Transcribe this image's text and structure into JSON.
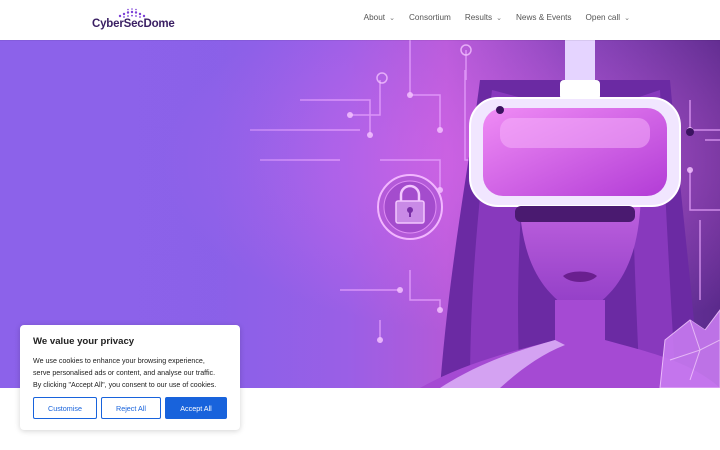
{
  "brand": {
    "name": "CyberSecDome"
  },
  "nav": {
    "items": [
      {
        "label": "About",
        "has_dropdown": true
      },
      {
        "label": "Consortium",
        "has_dropdown": false
      },
      {
        "label": "Results",
        "has_dropdown": true
      },
      {
        "label": "News & Events",
        "has_dropdown": false
      },
      {
        "label": "Open call",
        "has_dropdown": true
      }
    ],
    "chevron": "⌄"
  },
  "hero": {
    "illustration": "vr-headset-woman-circuit-lock",
    "icon": "padlock-icon"
  },
  "cookie_banner": {
    "title": "We value your privacy",
    "text_lines": [
      "We use cookies to enhance your browsing experience,",
      "serve personalised ads or content, and analyse our traffic.",
      "By clicking \"Accept All\", you consent to our use of cookies."
    ],
    "buttons": {
      "customise": "Customise",
      "reject": "Reject All",
      "accept": "Accept All"
    }
  },
  "colors": {
    "accent": "#1863dc",
    "brand_text": "#3a1f63",
    "hero_purple": "#8c62ea",
    "hero_magenta": "#c94fe0"
  }
}
